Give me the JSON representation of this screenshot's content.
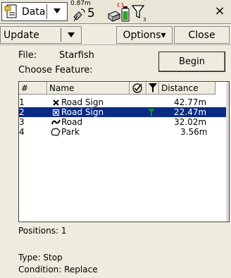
{
  "topbar": {
    "data_label": "Data",
    "gps_accuracy": "0.87m",
    "satellite_count": "5",
    "filter_count": "3",
    "close_symbol": "×"
  },
  "toolbar": {
    "update_label": "Update",
    "options_label": "Options▾",
    "close_label": "Close"
  },
  "form": {
    "file_label": "File:",
    "file_value": "Starfish",
    "choose_label": "Choose Feature:",
    "begin_label": "Begin"
  },
  "list": {
    "headers": {
      "num": "#",
      "name": "Name",
      "distance": "Distance"
    },
    "rows": [
      {
        "num": "1",
        "icon": "x-mark-icon",
        "name": "Road Sign",
        "distance": "42.77m",
        "selected": false,
        "filtered": false
      },
      {
        "num": "2",
        "icon": "box-x-icon",
        "name": "Road Sign",
        "distance": "22.47m",
        "selected": true,
        "filtered": true
      },
      {
        "num": "3",
        "icon": "line-icon",
        "name": "Road",
        "distance": "32.02m",
        "selected": false,
        "filtered": false
      },
      {
        "num": "4",
        "icon": "polygon-icon",
        "name": "Park",
        "distance": "3.56m",
        "selected": false,
        "filtered": false
      }
    ]
  },
  "footer": {
    "positions": "Positions: 1",
    "type": "Type: Stop",
    "condition": "Condition: Replace"
  },
  "colors": {
    "selection": "#0a2a84",
    "filter_green": "#1a8a1a"
  }
}
